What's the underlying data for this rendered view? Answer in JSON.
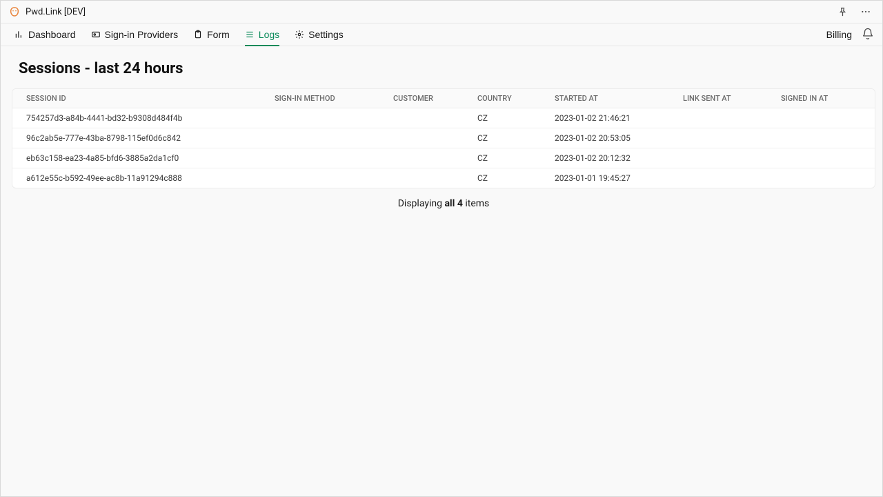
{
  "app": {
    "title": "Pwd.Link [DEV]"
  },
  "nav": {
    "items": [
      {
        "label": "Dashboard",
        "active": false
      },
      {
        "label": "Sign-in Providers",
        "active": false
      },
      {
        "label": "Form",
        "active": false
      },
      {
        "label": "Logs",
        "active": true
      },
      {
        "label": "Settings",
        "active": false
      }
    ],
    "billing": "Billing"
  },
  "page": {
    "title": "Sessions - last 24 hours"
  },
  "table": {
    "headers": [
      "SESSION ID",
      "SIGN-IN METHOD",
      "CUSTOMER",
      "COUNTRY",
      "STARTED AT",
      "LINK SENT AT",
      "SIGNED IN AT"
    ],
    "rows": [
      {
        "session_id": "754257d3-a84b-4441-bd32-b9308d484f4b",
        "method": "",
        "customer": "",
        "country": "CZ",
        "started_at": "2023-01-02 21:46:21",
        "link_sent_at": "",
        "signed_in_at": ""
      },
      {
        "session_id": "96c2ab5e-777e-43ba-8798-115ef0d6c842",
        "method": "",
        "customer": "",
        "country": "CZ",
        "started_at": "2023-01-02 20:53:05",
        "link_sent_at": "",
        "signed_in_at": ""
      },
      {
        "session_id": "eb63c158-ea23-4a85-bfd6-3885a2da1cf0",
        "method": "",
        "customer": "",
        "country": "CZ",
        "started_at": "2023-01-02 20:12:32",
        "link_sent_at": "",
        "signed_in_at": ""
      },
      {
        "session_id": "a612e55c-b592-49ee-ac8b-11a91294c888",
        "method": "",
        "customer": "",
        "country": "CZ",
        "started_at": "2023-01-01 19:45:27",
        "link_sent_at": "",
        "signed_in_at": ""
      }
    ]
  },
  "summary": {
    "prefix": "Displaying ",
    "bold": "all 4",
    "suffix": " items"
  }
}
